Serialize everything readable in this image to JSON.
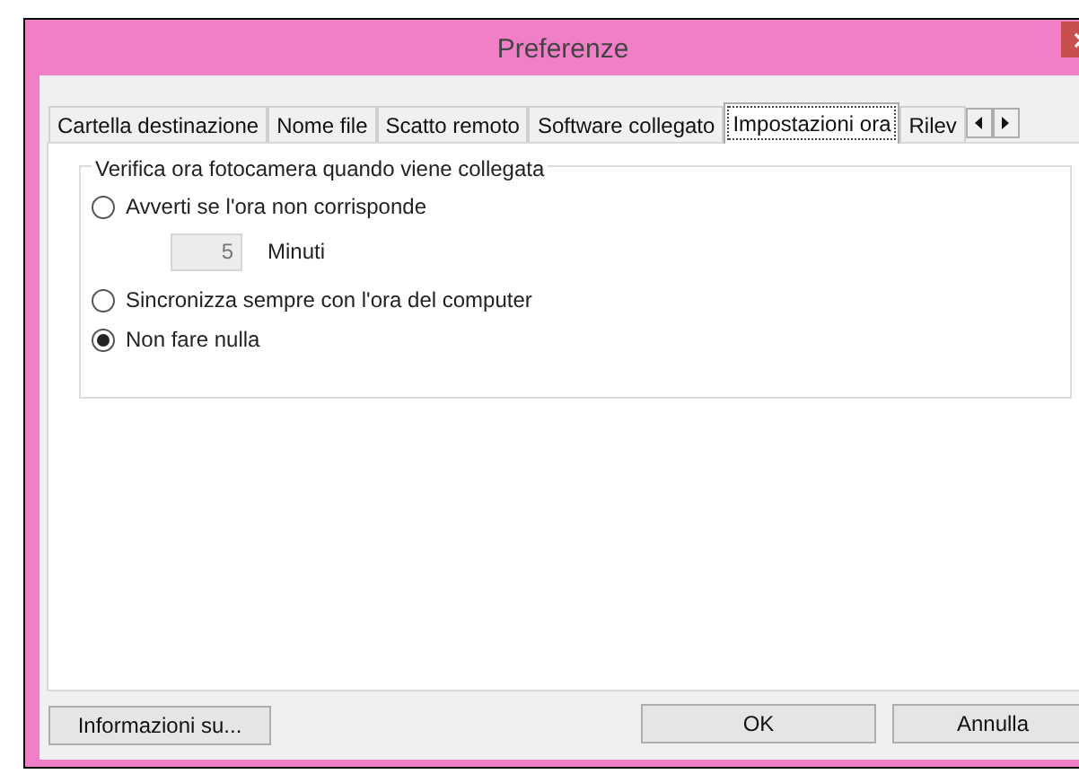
{
  "window": {
    "title": "Preferenze"
  },
  "tabs": [
    {
      "label": "Cartella destinazione",
      "selected": false
    },
    {
      "label": "Nome file",
      "selected": false
    },
    {
      "label": "Scatto remoto",
      "selected": false
    },
    {
      "label": "Software collegato",
      "selected": false
    },
    {
      "label": "Impostazioni ora",
      "selected": true
    },
    {
      "label": "Rilev",
      "selected": false
    }
  ],
  "group": {
    "title": "Verifica ora fotocamera quando viene collegata",
    "options": [
      {
        "label": "Avverti se l'ora non corrisponde",
        "selected": false
      },
      {
        "label": "Sincronizza sempre con l'ora del computer",
        "selected": false
      },
      {
        "label": "Non fare nulla",
        "selected": true
      }
    ],
    "minutes": {
      "value": "5",
      "unit": "Minuti",
      "disabled": true
    }
  },
  "buttons": {
    "about": "Informazioni su...",
    "ok": "OK",
    "cancel": "Annulla"
  }
}
